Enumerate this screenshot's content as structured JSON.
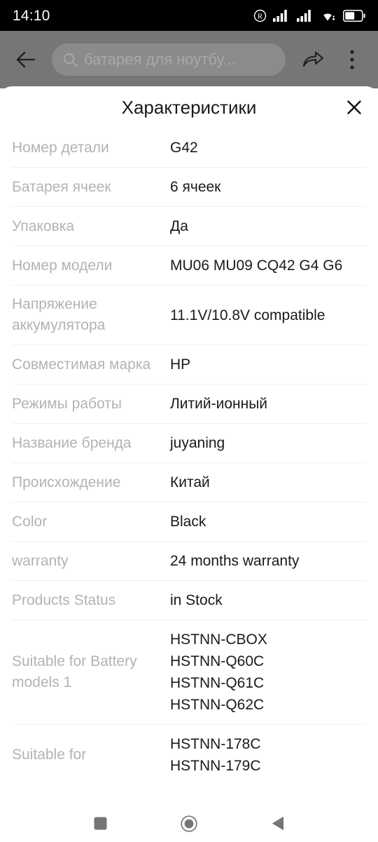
{
  "status_bar": {
    "clock": "14:10",
    "icons": [
      "registered-mark-icon",
      "signal-1-icon",
      "signal-2-icon",
      "wifi-icon",
      "battery-icon"
    ],
    "battery_level_percent": 55,
    "background_color": "#000000",
    "foreground_color": "#ffffff"
  },
  "app_bar": {
    "back_label": "back-arrow-icon",
    "search_text": "батарея для ноутбу...",
    "search_placeholder": "батарея для ноутбу...",
    "share_label": "share-icon",
    "more_label": "more-vertical-icon",
    "background_color": "#767676",
    "pill_color": "#8b8b8b"
  },
  "sheet": {
    "title": "Характеристики",
    "close_label": "×",
    "label_color": "#b3b3b3",
    "value_color": "#1a1a1a",
    "divider_color": "#f0f0f0",
    "specs": [
      {
        "label": "Номер детали",
        "value": "G42"
      },
      {
        "label": "Батарея ячеек",
        "value": "6 ячеек"
      },
      {
        "label": "Упаковка",
        "value": "Да"
      },
      {
        "label": "Номер модели",
        "value": "MU06 MU09 CQ42 G4 G6"
      },
      {
        "label": "Напряжение аккумулятора",
        "value": "11.1V/10.8V compatible"
      },
      {
        "label": "Совместимая марка",
        "value": "HP"
      },
      {
        "label": "Режимы работы",
        "value": "Литий-ионный"
      },
      {
        "label": "Название бренда",
        "value": "juyaning"
      },
      {
        "label": "Происхождение",
        "value": "Китай"
      },
      {
        "label": "Color",
        "value": "Black"
      },
      {
        "label": "warranty",
        "value": "24 months warranty"
      },
      {
        "label": "Products Status",
        "value": "in Stock"
      },
      {
        "label": "Suitable for Battery models 1",
        "value": "HSTNN-CBOX\nHSTNN-Q60C\nHSTNN-Q61C\nHSTNN-Q62C"
      },
      {
        "label": "Suitable for",
        "value": "HSTNN-178C\nHSTNN-179C"
      }
    ]
  },
  "nav_bar": {
    "recents_label": "recents-square-icon",
    "home_label": "home-circle-icon",
    "back_label": "back-triangle-icon",
    "icon_color": "#757575"
  }
}
